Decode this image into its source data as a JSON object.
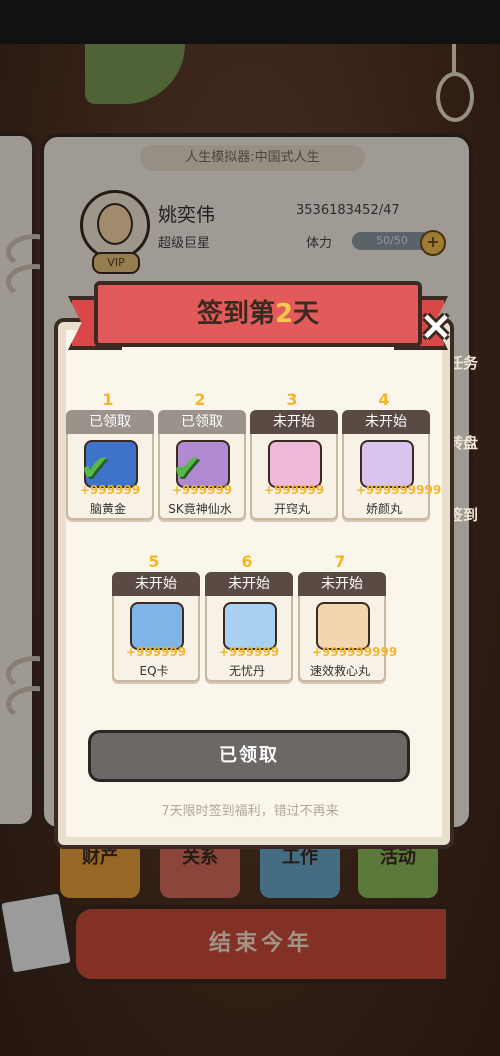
{
  "background": {
    "sim_title": "人生模拟器:中国式人生",
    "player": {
      "name": "姚奕伟",
      "rank": "超级巨星",
      "vip_badge": "VIP",
      "money": "3536183452/47",
      "stamina_label": "体力",
      "stamina_value": "50/50"
    },
    "side_tabs": [
      "任务",
      "转盘",
      "签到"
    ],
    "bottom_tabs": [
      "财产",
      "关系",
      "工作",
      "活动"
    ],
    "end_year_button": "结束今年"
  },
  "modal": {
    "title_prefix": "签到第",
    "title_day": "2",
    "title_suffix": "天",
    "close_icon": "×",
    "days": [
      {
        "num": "1",
        "status": "已领取",
        "state": "claimed",
        "qty": "+999999",
        "name": "脑黄金",
        "icon": "potion-bottle-icon"
      },
      {
        "num": "2",
        "status": "已领取",
        "state": "claimed",
        "qty": "+999999",
        "name": "SK竟神仙水",
        "icon": "skincare-bottle-icon"
      },
      {
        "num": "3",
        "status": "未开始",
        "state": "pending",
        "qty": "+999999",
        "name": "开窍丸",
        "icon": "brain-card-icon"
      },
      {
        "num": "4",
        "status": "未开始",
        "state": "pending",
        "qty": "+999999999",
        "name": "娇颜丸",
        "icon": "face-card-icon"
      },
      {
        "num": "5",
        "status": "未开始",
        "state": "pending",
        "qty": "+999999",
        "name": "EQ卡",
        "icon": "eq-card-icon"
      },
      {
        "num": "6",
        "status": "未开始",
        "state": "pending",
        "qty": "+999999",
        "name": "无忧丹",
        "icon": "smile-card-icon"
      },
      {
        "num": "7",
        "status": "未开始",
        "state": "pending",
        "qty": "+999999999",
        "name": "速效救心丸",
        "icon": "heart-pill-card-icon"
      }
    ],
    "claim_button": "已领取",
    "footer_note": "7天限时签到福利，错过不再来"
  },
  "colors": {
    "ribbon": "#e25a5a",
    "gold": "#f2b62c",
    "claimed_header": "#9b938b",
    "pending_header": "#5a4a44"
  }
}
